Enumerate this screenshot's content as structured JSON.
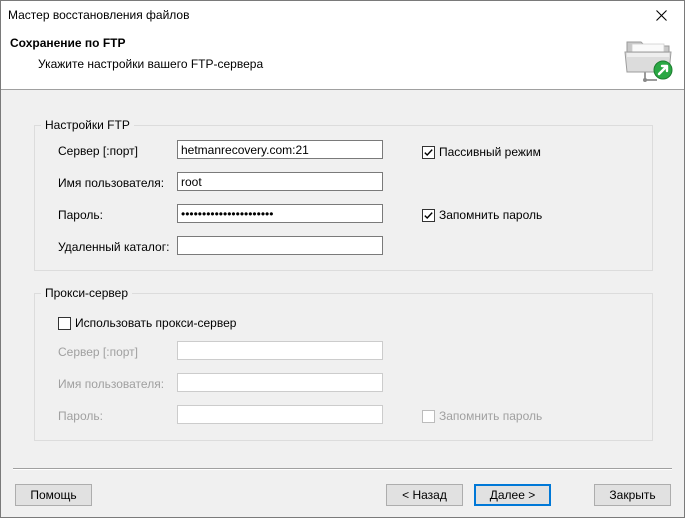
{
  "window": {
    "title": "Мастер восстановления файлов"
  },
  "header": {
    "title": "Сохранение по FTP",
    "subtitle": "Укажите настройки вашего FTP-сервера",
    "icon": "ftp-folder-icon"
  },
  "ftp": {
    "legend": "Настройки FTP",
    "server_label": "Сервер [:порт]",
    "server_value": "hetmanrecovery.com:21",
    "user_label": "Имя пользователя:",
    "user_value": "root",
    "password_label": "Пароль:",
    "password_value": "••••••••••••••••••••••",
    "remote_dir_label": "Удаленный каталог:",
    "remote_dir_value": "",
    "passive_label": "Пассивный режим",
    "passive_checked": true,
    "remember_label": "Запомнить пароль",
    "remember_checked": true
  },
  "proxy": {
    "legend": "Прокси-сервер",
    "use_proxy_label": "Использовать прокси-сервер",
    "use_proxy_checked": false,
    "server_label": "Сервер [:порт]",
    "server_value": "",
    "user_label": "Имя пользователя:",
    "user_value": "",
    "password_label": "Пароль:",
    "password_value": "",
    "remember_label": "Запомнить пароль",
    "remember_checked": false
  },
  "buttons": {
    "help": "Помощь",
    "back": "< Назад",
    "next": "Далее >",
    "close": "Закрыть"
  }
}
